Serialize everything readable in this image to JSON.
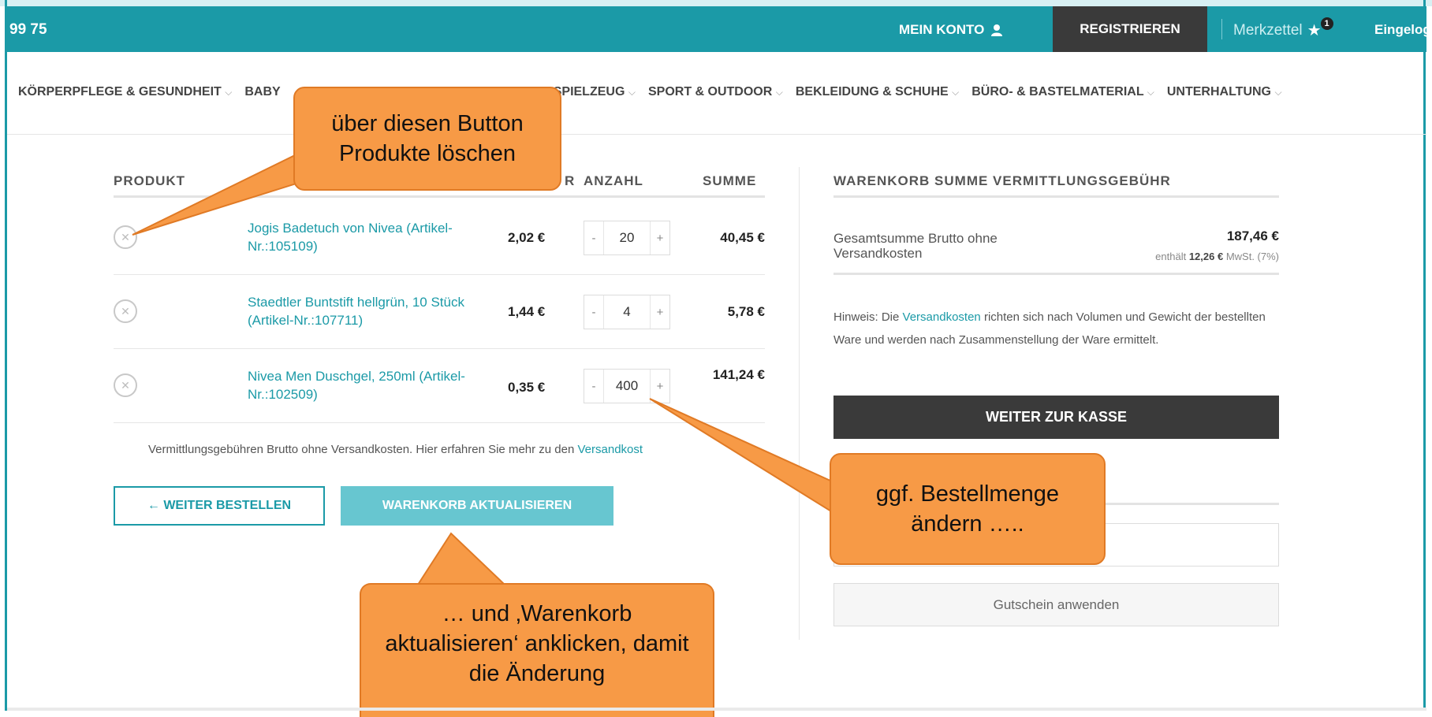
{
  "topbar": {
    "phone": "99 75",
    "account_label": "MEIN KONTO",
    "register_label": "REGISTRIEREN",
    "wishlist_label": "Merkzettel",
    "wishlist_count": "1",
    "login_status": "Eingeloggt"
  },
  "categories": [
    {
      "label": "KÖRPERPFLEGE & GESUNDHEIT"
    },
    {
      "label": "BABY"
    },
    {
      "label": "SPIELZEUG"
    },
    {
      "label": "SPORT & OUTDOOR"
    },
    {
      "label": "BEKLEIDUNG & SCHUHE"
    },
    {
      "label": "BÜRO- & BASTELMATERIAL"
    },
    {
      "label": "UNTERHALTUNG"
    }
  ],
  "cart": {
    "headers": {
      "product": "PRODUKT",
      "price_fragment": "R",
      "quantity": "ANZAHL",
      "sum": "SUMME"
    },
    "rows": [
      {
        "name": "Jogis Badetuch von Nivea (Artikel-Nr.:105109)",
        "price": "2,02 €",
        "qty": "20",
        "sum": "40,45 €"
      },
      {
        "name": "Staedtler Buntstift hellgrün, 10 Stück (Artikel-Nr.:107711)",
        "price": "1,44 €",
        "qty": "4",
        "sum": "5,78 €"
      },
      {
        "name": "Nivea Men Duschgel, 250ml (Artikel-Nr.:102509)",
        "price": "0,35 €",
        "qty": "400",
        "sum": "141,24 €"
      }
    ],
    "note": "Vermittlungsgebühren Brutto ohne Versandkosten. Hier erfahren Sie mehr zu den ",
    "note_link": "Versandkost",
    "continue_label": "← WEITER BESTELLEN",
    "update_label": "WARENKORB AKTUALISIEREN"
  },
  "summary": {
    "title": "WARENKORB SUMME VERMITTLUNGSGEBÜHR",
    "total_label": "Gesamtsumme Brutto ohne Versandkosten",
    "total_value": "187,46 €",
    "tax_prefix": "enthält ",
    "tax_value": "12,26 €",
    "tax_suffix": " MwSt. (7%)",
    "hint_pre": "Hinweis: Die ",
    "hint_link": "Versandkosten",
    "hint_post": " richten sich nach Volumen und Gewicht der bestellten Ware und werden nach Zusammenstellung der Ware ermittelt.",
    "checkout_label": "WEITER ZUR KASSE",
    "coupon_button_label": "Gutschein anwenden"
  },
  "callouts": {
    "delete": "über diesen Button Produkte löschen",
    "quantity": "ggf. Bestellmenge ändern …..",
    "update": "… und ‚Warenkorb aktualisieren‘ anklicken, damit die Änderung"
  },
  "colors": {
    "accent": "#1b9aa7",
    "dark": "#3a3a3a",
    "callout": "#f79a46"
  }
}
